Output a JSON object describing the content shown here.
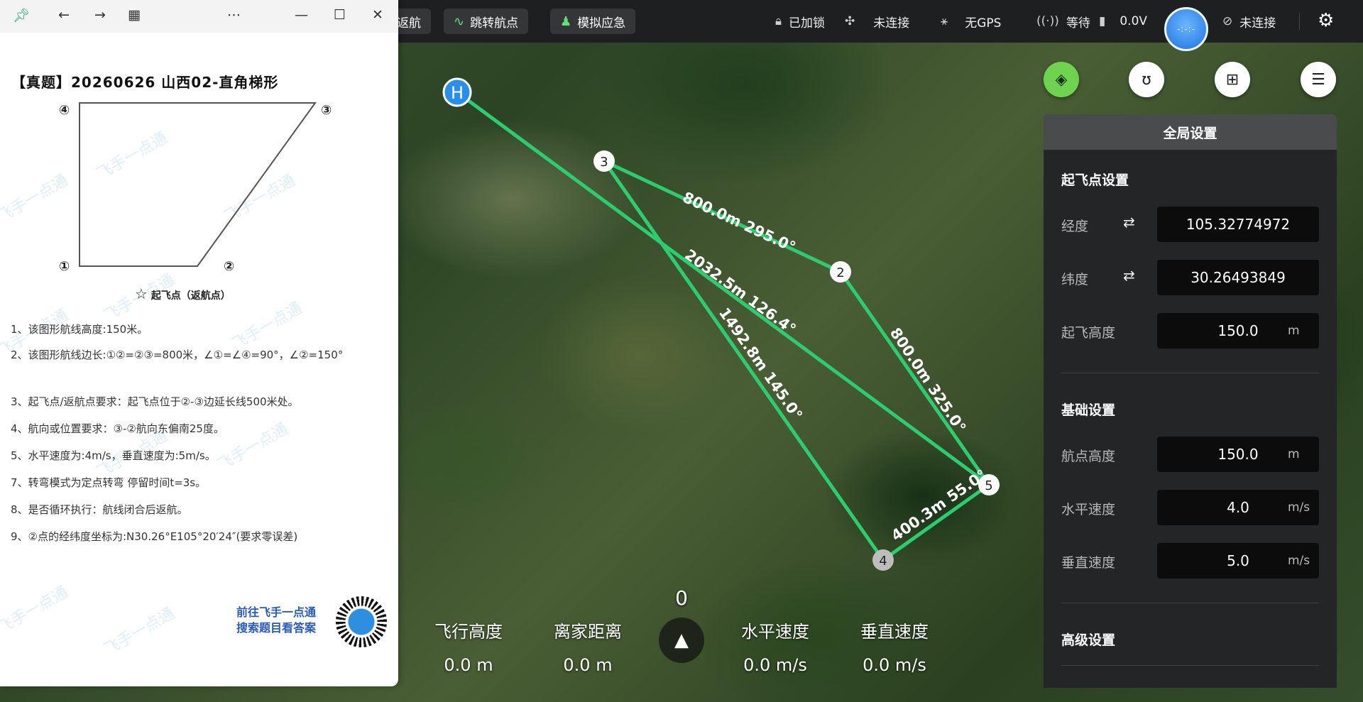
{
  "topbar": {
    "btn_return": "返航",
    "btn_jump": "跳转航点",
    "btn_emergency": "模拟应急",
    "lock_status": "已加锁",
    "link_status": "未连接",
    "gps_status": "无GPS",
    "wait_status": "等待",
    "voltage": "0.0V",
    "attitude_text": "-:-:-",
    "remote_status": "未连接",
    "icons": {
      "return": "return-icon",
      "jump": "route-icon",
      "emergency": "person-icon",
      "lock": "lock-icon",
      "link": "drone-icon",
      "gps": "satellite-icon",
      "signal": "signal-icon",
      "battery": "battery-icon",
      "remote": "unlink-icon",
      "settings": "gear-icon"
    },
    "accent_color": "#5ee07a"
  },
  "map_buttons": {
    "layers": "layers-icon",
    "route": "route-icon",
    "grid": "grid-icon",
    "list": "list-icon"
  },
  "route": {
    "home_label": "H",
    "waypoints": [
      "2",
      "3",
      "4",
      "5"
    ],
    "segments": [
      {
        "label": "800.0m 295.0°"
      },
      {
        "label": "2032.5m 126.4°"
      },
      {
        "label": "1492.8m 145.0°"
      },
      {
        "label": "800.0m 325.0°"
      },
      {
        "label": "400.3m 55.0°"
      }
    ],
    "line_color": "#2ecc71"
  },
  "panel": {
    "title": "全局设置",
    "takeoff_section": "起飞点设置",
    "longitude_label": "经度",
    "longitude_value": "105.32774972",
    "latitude_label": "纬度",
    "latitude_value": "30.26493849",
    "takeoff_alt_label": "起飞高度",
    "takeoff_alt_value": "150.0",
    "takeoff_alt_unit": "m",
    "basic_section": "基础设置",
    "wp_alt_label": "航点高度",
    "wp_alt_value": "150.0",
    "wp_alt_unit": "m",
    "hspeed_label": "水平速度",
    "hspeed_value": "4.0",
    "hspeed_unit": "m/s",
    "vspeed_label": "垂直速度",
    "vspeed_value": "5.0",
    "vspeed_unit": "m/s",
    "advanced_section": "高级设置"
  },
  "telemetry": {
    "heading": "0",
    "alt_label": "飞行高度",
    "alt_value": "0.0 m",
    "dist_label": "离家距离",
    "dist_value": "0.0 m",
    "hspeed_label": "水平速度",
    "hspeed_value": "0.0 m/s",
    "vspeed_label": "垂直速度",
    "vspeed_value": "0.0 m/s"
  },
  "doc_window": {
    "title": "【真题】20260626 山西02-直角梯形",
    "corner_labels": [
      "④",
      "③",
      "①",
      "②"
    ],
    "legend": "起飞点（返航点）",
    "rules": [
      "1、该图形航线高度:150米。",
      "2、该图形航线边长:①②=②③=800米，∠①=∠④=90°，∠②=150°",
      "3、起飞点/返航点要求：起飞点位于②-③边延长线500米处。",
      "4、航向或位置要求：③-②航向东偏南25度。",
      "5、水平速度为:4m/s，垂直速度为:5m/s。",
      "7、转弯模式为定点转弯 停留时间t=3s。",
      "8、是否循环执行：航线闭合后返航。",
      "9、②点的经纬度坐标为:N30.26°E105°20′24″(要求零误差)"
    ],
    "promo_line1": "前往飞手一点通",
    "promo_line2": "搜索题目看答案",
    "watermark": "飞手一点通"
  }
}
